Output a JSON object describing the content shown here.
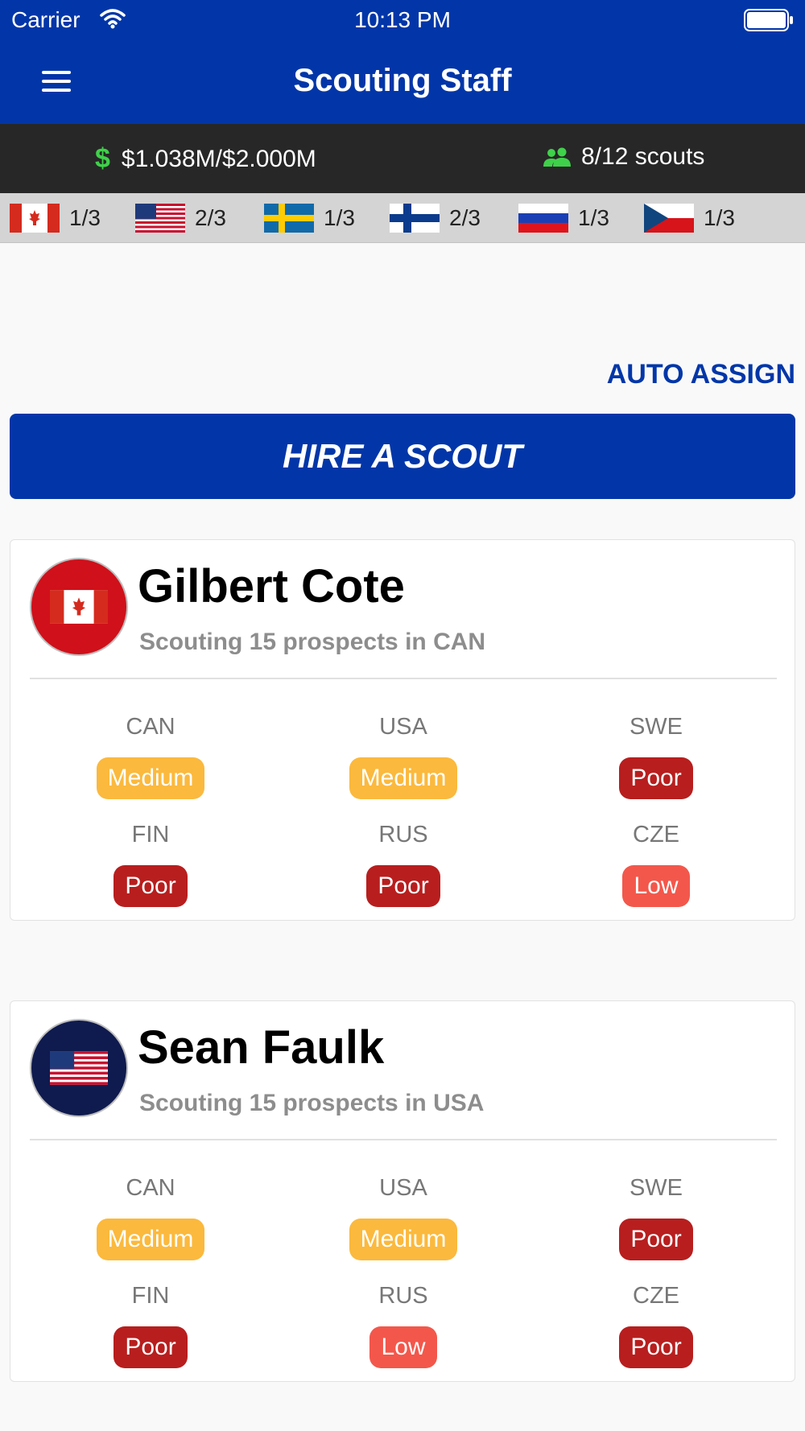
{
  "status_bar": {
    "carrier": "Carrier",
    "time": "10:13 PM"
  },
  "header": {
    "title": "Scouting Staff"
  },
  "summary": {
    "budget": "$1.038M/$2.000M",
    "scouts": "8/12 scouts"
  },
  "country_slots": [
    {
      "country": "CAN",
      "count": "1/3"
    },
    {
      "country": "USA",
      "count": "2/3"
    },
    {
      "country": "SWE",
      "count": "1/3"
    },
    {
      "country": "FIN",
      "count": "2/3"
    },
    {
      "country": "RUS",
      "count": "1/3"
    },
    {
      "country": "CZE",
      "count": "1/3"
    }
  ],
  "actions": {
    "auto_assign": "AUTO ASSIGN",
    "hire": "HIRE A SCOUT"
  },
  "scouts": [
    {
      "name": "Gilbert Cote",
      "assignment": "Scouting 15 prospects in CAN",
      "flag": "CAN",
      "ratings": [
        {
          "country": "CAN",
          "level": "Medium"
        },
        {
          "country": "USA",
          "level": "Medium"
        },
        {
          "country": "SWE",
          "level": "Poor"
        },
        {
          "country": "FIN",
          "level": "Poor"
        },
        {
          "country": "RUS",
          "level": "Poor"
        },
        {
          "country": "CZE",
          "level": "Low"
        }
      ]
    },
    {
      "name": "Sean Faulk",
      "assignment": "Scouting 15 prospects in USA",
      "flag": "USA",
      "ratings": [
        {
          "country": "CAN",
          "level": "Medium"
        },
        {
          "country": "USA",
          "level": "Medium"
        },
        {
          "country": "SWE",
          "level": "Poor"
        },
        {
          "country": "FIN",
          "level": "Poor"
        },
        {
          "country": "RUS",
          "level": "Low"
        },
        {
          "country": "CZE",
          "level": "Poor"
        }
      ]
    }
  ],
  "colors": {
    "primary": "#0236a8",
    "medium": "#fbb93d",
    "poor": "#b81e1e",
    "low": "#f3574b",
    "money": "#3fd14a"
  }
}
